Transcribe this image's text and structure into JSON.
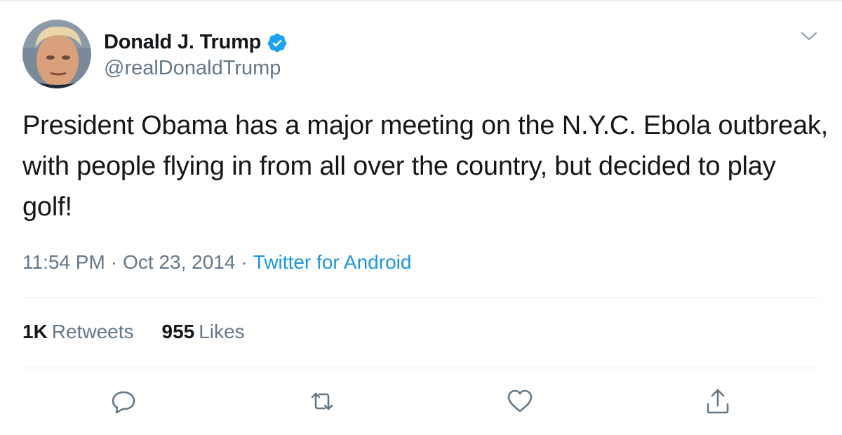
{
  "colors": {
    "text": "#14171a",
    "secondary": "#657786",
    "link": "#1b95e0",
    "verified": "#1da1f2",
    "divider": "#e6ecf0"
  },
  "author": {
    "display_name": "Donald J. Trump",
    "handle": "@realDonaldTrump",
    "verified": true,
    "avatar_icon": "avatar-photo"
  },
  "tweet": {
    "text": "President Obama has a major meeting on the N.Y.C. Ebola outbreak, with people flying in from all over the country, but decided to play golf!",
    "time": "11:54 PM",
    "separator": "·",
    "date": "Oct 23, 2014",
    "source": "Twitter for Android"
  },
  "stats": {
    "retweets_count": "1K",
    "retweets_label": "Retweets",
    "likes_count": "955",
    "likes_label": "Likes"
  },
  "icons": {
    "caret": "chevron-down-icon",
    "reply": "reply-icon",
    "retweet": "retweet-icon",
    "like": "heart-icon",
    "share": "share-icon"
  }
}
